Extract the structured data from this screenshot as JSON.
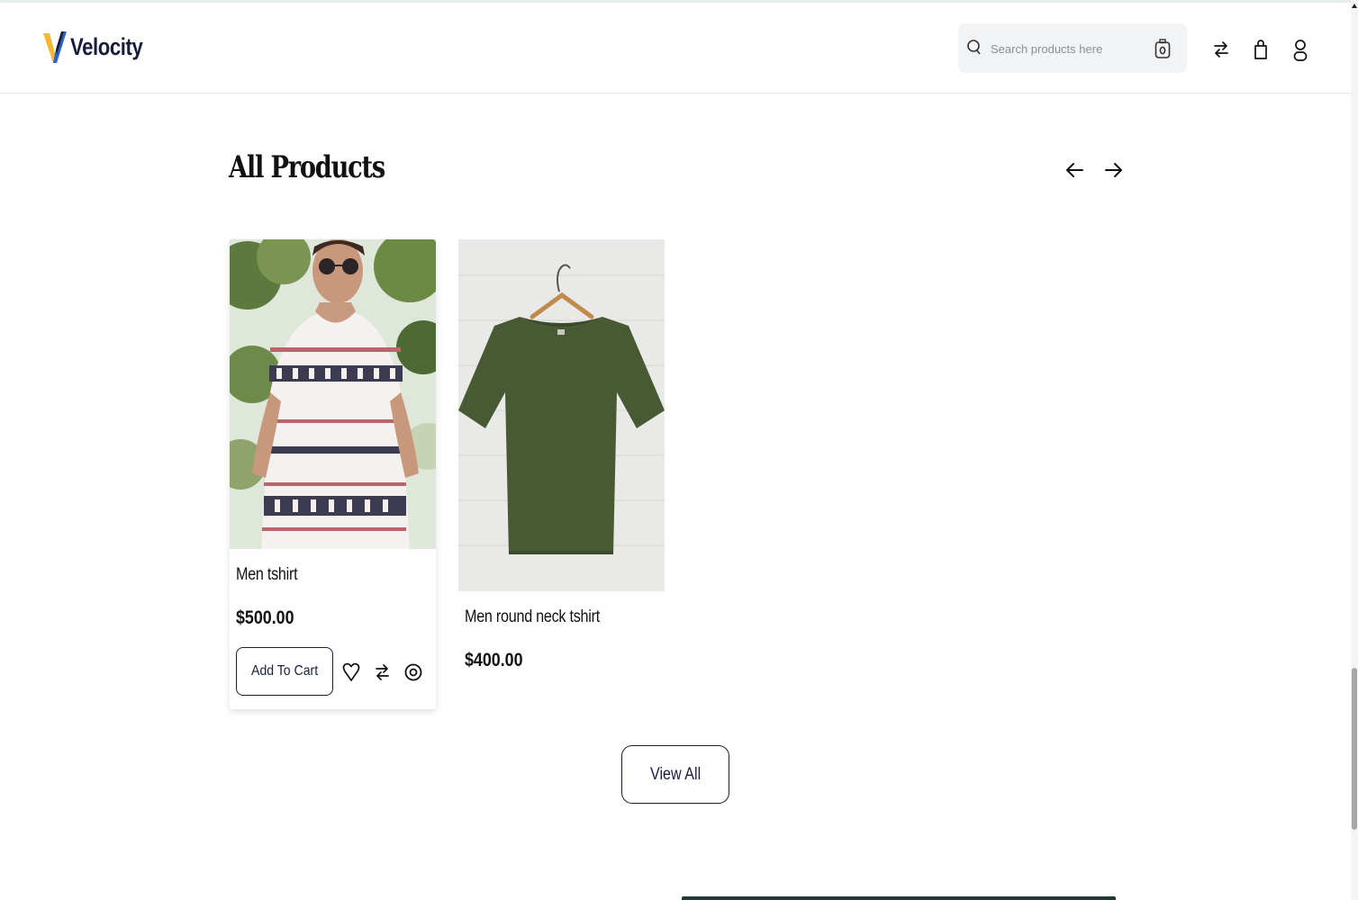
{
  "header": {
    "brand": "Velocity",
    "search_placeholder": "Search products here",
    "icons": [
      "search-icon",
      "camera-icon",
      "compare-icon",
      "cart-icon",
      "user-icon"
    ]
  },
  "section": {
    "title": "All Products",
    "nav_icons": [
      "arrow-left-icon",
      "arrow-right-icon"
    ]
  },
  "products": [
    {
      "name": "Men tshirt",
      "price": "$500.00",
      "add_to_cart_label": "Add To Cart",
      "action_icons": [
        "heart-icon",
        "compare-icon",
        "quick-view-icon"
      ]
    },
    {
      "name": "Men round neck tshirt",
      "price": "$400.00"
    }
  ],
  "view_all_label": "View All",
  "colors": {
    "brand_navy": "#1a1d3a",
    "logo_yellow": "#f5b82e",
    "logo_blue": "#2b63c9",
    "shirt_olive": "#485a34"
  }
}
